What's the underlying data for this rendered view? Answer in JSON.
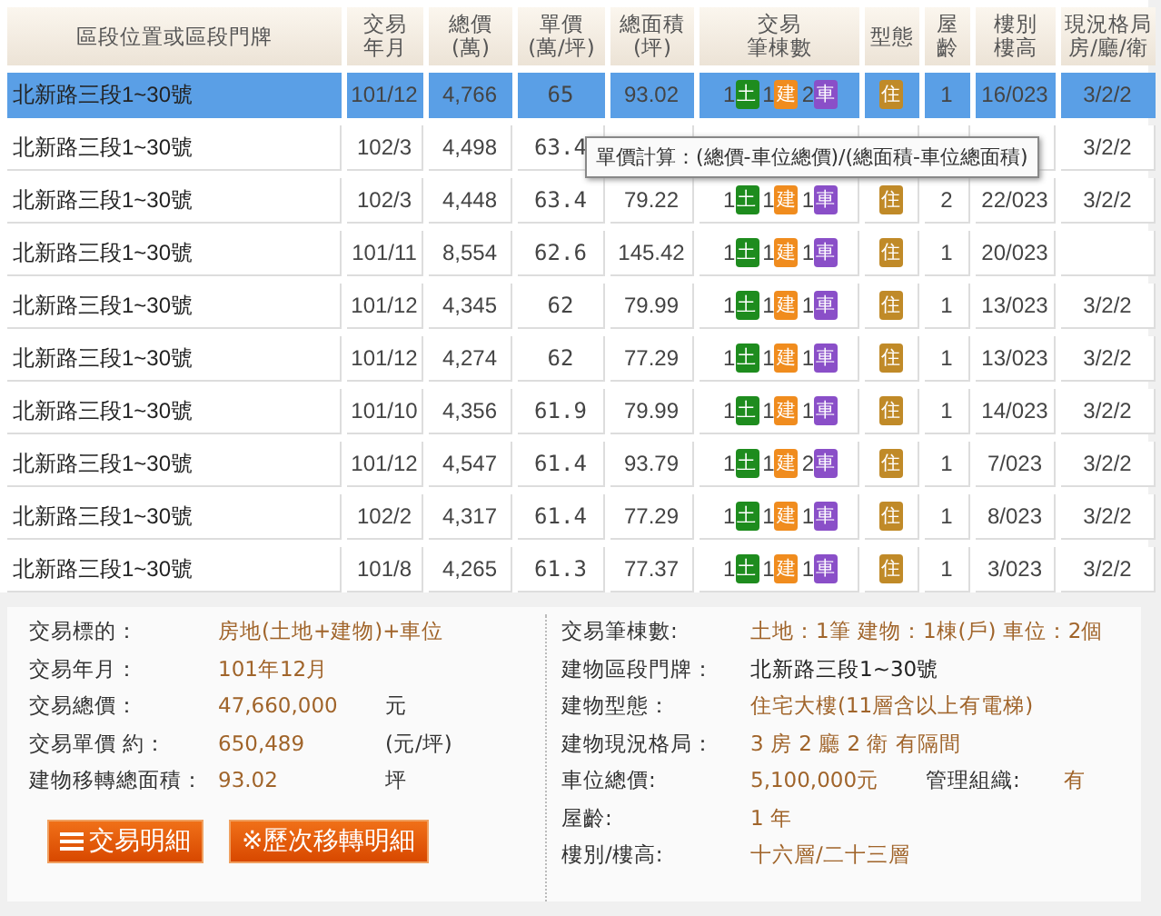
{
  "table": {
    "columns": [
      [
        "區段位置或區段門牌"
      ],
      [
        "交易",
        "年月"
      ],
      [
        "總價",
        "(萬)"
      ],
      [
        "單價",
        "(萬/坪)"
      ],
      [
        "總面積",
        "(坪)"
      ],
      [
        "交易",
        "筆棟數"
      ],
      [
        "型態"
      ],
      [
        "屋",
        "齡"
      ],
      [
        "樓別",
        "樓高"
      ],
      [
        "現況格局",
        "房/廳/衛"
      ]
    ],
    "rows": [
      {
        "selected": true,
        "address": "北新路三段1~30號",
        "ym": "101/12",
        "price": "4,766",
        "unit": "65",
        "area": "93.02",
        "counts": [
          {
            "kind": "land",
            "count": "1",
            "label": "土"
          },
          {
            "kind": "building",
            "count": "1",
            "label": "建"
          },
          {
            "kind": "parking",
            "count": "2",
            "label": "車"
          }
        ],
        "type": "住",
        "age": "1",
        "floor": "16/023",
        "layout": "3/2/2"
      },
      {
        "selected": false,
        "address": "北新路三段1~30號",
        "ym": "102/3",
        "price": "4,498",
        "unit": "63.4",
        "layout": "3/2/2"
      },
      {
        "selected": false,
        "address": "北新路三段1~30號",
        "ym": "102/3",
        "price": "4,448",
        "unit": "63.4",
        "area": "79.22",
        "counts": [
          {
            "kind": "land",
            "count": "1",
            "label": "土"
          },
          {
            "kind": "building",
            "count": "1",
            "label": "建"
          },
          {
            "kind": "parking",
            "count": "1",
            "label": "車"
          }
        ],
        "type": "住",
        "age": "2",
        "floor": "22/023",
        "layout": "3/2/2"
      },
      {
        "selected": false,
        "address": "北新路三段1~30號",
        "ym": "101/11",
        "price": "8,554",
        "unit": "62.6",
        "area": "145.42",
        "counts": [
          {
            "kind": "land",
            "count": "1",
            "label": "土"
          },
          {
            "kind": "building",
            "count": "1",
            "label": "建"
          },
          {
            "kind": "parking",
            "count": "1",
            "label": "車"
          }
        ],
        "type": "住",
        "age": "1",
        "floor": "20/023"
      },
      {
        "selected": false,
        "address": "北新路三段1~30號",
        "ym": "101/12",
        "price": "4,345",
        "unit": "62",
        "area": "79.99",
        "counts": [
          {
            "kind": "land",
            "count": "1",
            "label": "土"
          },
          {
            "kind": "building",
            "count": "1",
            "label": "建"
          },
          {
            "kind": "parking",
            "count": "1",
            "label": "車"
          }
        ],
        "type": "住",
        "age": "1",
        "floor": "13/023",
        "layout": "3/2/2"
      },
      {
        "selected": false,
        "address": "北新路三段1~30號",
        "ym": "101/12",
        "price": "4,274",
        "unit": "62",
        "area": "77.29",
        "counts": [
          {
            "kind": "land",
            "count": "1",
            "label": "土"
          },
          {
            "kind": "building",
            "count": "1",
            "label": "建"
          },
          {
            "kind": "parking",
            "count": "1",
            "label": "車"
          }
        ],
        "type": "住",
        "age": "1",
        "floor": "13/023",
        "layout": "3/2/2"
      },
      {
        "selected": false,
        "address": "北新路三段1~30號",
        "ym": "101/10",
        "price": "4,356",
        "unit": "61.9",
        "area": "79.99",
        "counts": [
          {
            "kind": "land",
            "count": "1",
            "label": "土"
          },
          {
            "kind": "building",
            "count": "1",
            "label": "建"
          },
          {
            "kind": "parking",
            "count": "1",
            "label": "車"
          }
        ],
        "type": "住",
        "age": "1",
        "floor": "14/023",
        "layout": "3/2/2"
      },
      {
        "selected": false,
        "address": "北新路三段1~30號",
        "ym": "101/12",
        "price": "4,547",
        "unit": "61.4",
        "area": "93.79",
        "counts": [
          {
            "kind": "land",
            "count": "1",
            "label": "土"
          },
          {
            "kind": "building",
            "count": "1",
            "label": "建"
          },
          {
            "kind": "parking",
            "count": "2",
            "label": "車"
          }
        ],
        "type": "住",
        "age": "1",
        "floor": "7/023",
        "layout": "3/2/2"
      },
      {
        "selected": false,
        "address": "北新路三段1~30號",
        "ym": "102/2",
        "price": "4,317",
        "unit": "61.4",
        "area": "77.29",
        "counts": [
          {
            "kind": "land",
            "count": "1",
            "label": "土"
          },
          {
            "kind": "building",
            "count": "1",
            "label": "建"
          },
          {
            "kind": "parking",
            "count": "1",
            "label": "車"
          }
        ],
        "type": "住",
        "age": "1",
        "floor": "8/023",
        "layout": "3/2/2"
      },
      {
        "selected": false,
        "address": "北新路三段1~30號",
        "ym": "101/8",
        "price": "4,265",
        "unit": "61.3",
        "area": "77.37",
        "counts": [
          {
            "kind": "land",
            "count": "1",
            "label": "土"
          },
          {
            "kind": "building",
            "count": "1",
            "label": "建"
          },
          {
            "kind": "parking",
            "count": "1",
            "label": "車"
          }
        ],
        "type": "住",
        "age": "1",
        "floor": "3/023",
        "layout": "3/2/2"
      }
    ]
  },
  "tooltip": "單價計算：(總價-車位總價)/(總面積-車位總面積)",
  "details": {
    "left": [
      {
        "label": "交易標的：",
        "value": "房地(土地+建物)+車位"
      },
      {
        "label": "交易年月：",
        "value": "101年12月"
      },
      {
        "label": "交易總價：",
        "value": "47,660,000",
        "unit": "元"
      },
      {
        "label": "交易單價 約：",
        "value": "650,489",
        "unit": "(元/坪)"
      },
      {
        "label": "建物移轉總面積：",
        "value": "93.02",
        "unit": "坪"
      }
    ],
    "buttons": [
      {
        "kind": "list",
        "label": "交易明細"
      },
      {
        "kind": "plain",
        "label": "※歷次移轉明細"
      }
    ],
    "right": [
      {
        "label": "交易筆棟數:",
        "value": "土地：1筆 建物：1棟(戶) 車位：2個"
      },
      {
        "label": "建物區段門牌：",
        "value": "北新路三段1~30號",
        "emphasis": true
      },
      {
        "label": "建物型態：",
        "value": "住宅大樓(11層含以上有電梯)"
      },
      {
        "label": "建物現況格局：",
        "value": "3 房 2 廳 2 衛 有隔間"
      },
      {
        "label": "車位總價:",
        "value": "5,100,000元",
        "extra_label": "管理組織:",
        "extra_value": "有"
      },
      {
        "label": "屋齡:",
        "value": "1  年"
      },
      {
        "label": "樓別/樓高:",
        "value": "十六層/二十三層"
      }
    ]
  }
}
